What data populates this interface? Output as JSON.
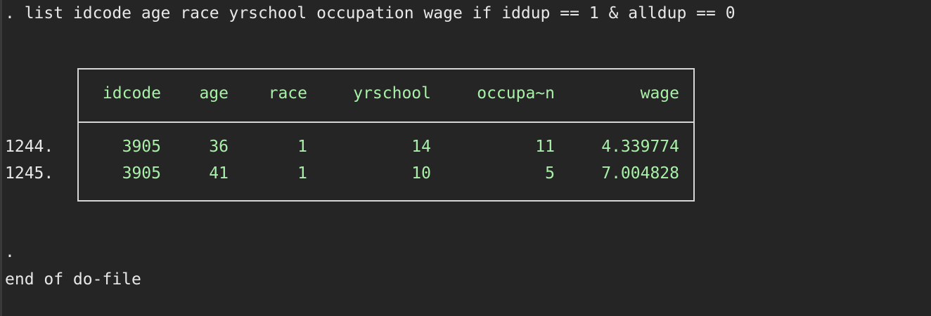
{
  "console": {
    "command": ". list idcode age race yrschool occupation wage if iddup == 1 & alldup == 0",
    "prompt_dot": ".",
    "end_message": "end of do-file"
  },
  "table": {
    "headers": [
      "idcode",
      "age",
      "race",
      "yrschool",
      "occupa~n",
      "wage"
    ],
    "rows": [
      {
        "obs": "1244.",
        "cells": [
          "3905",
          "36",
          "1",
          "14",
          "11",
          "4.339774"
        ]
      },
      {
        "obs": "1245.",
        "cells": [
          "3905",
          "41",
          "1",
          "10",
          "5",
          "7.004828"
        ]
      }
    ]
  },
  "colors": {
    "background": "#252525",
    "text": "#e8e8e8",
    "result_text": "#a8f0a8",
    "border": "#d6d6d6"
  }
}
